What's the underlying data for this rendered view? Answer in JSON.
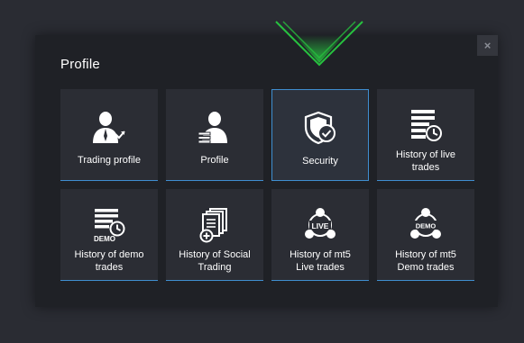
{
  "modal": {
    "title": "Profile",
    "close_label": "×"
  },
  "colors": {
    "accent_green": "#27c23f",
    "accent_blue": "#3f8ed0",
    "tile_bg": "#2b2d34",
    "modal_bg": "#1f2126"
  },
  "tiles": [
    {
      "label": "Trading profile",
      "icon": "trading-profile-icon",
      "active": false
    },
    {
      "label": "Profile",
      "icon": "profile-icon",
      "active": false
    },
    {
      "label": "Security",
      "icon": "security-shield-icon",
      "active": true
    },
    {
      "label": "History of live\ntrades",
      "icon": "history-live-trades-icon",
      "active": false
    },
    {
      "label": "History of demo\ntrades",
      "icon": "history-demo-trades-icon",
      "badge": "DEMO",
      "active": false
    },
    {
      "label": "History of Social\nTrading",
      "icon": "history-social-trading-icon",
      "active": false
    },
    {
      "label": "History of mt5\nLive trades",
      "icon": "mt5-live-icon",
      "badge": "LIVE",
      "active": false
    },
    {
      "label": "History of mt5\nDemo trades",
      "icon": "mt5-demo-icon",
      "badge": "DEMO",
      "active": false
    }
  ]
}
